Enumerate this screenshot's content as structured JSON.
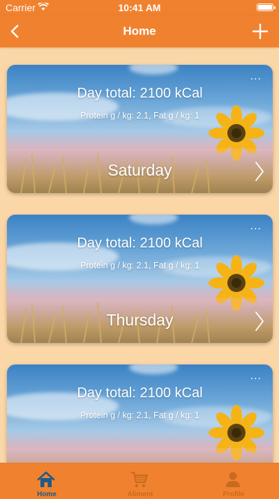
{
  "status": {
    "carrier": "Carrier",
    "time": "10:41 AM"
  },
  "navbar": {
    "title": "Home"
  },
  "colors": {
    "accent": "#f0822f",
    "background": "#fbd7a8",
    "tab_active": "#1f5a8a",
    "tab_inactive": "#c96a20"
  },
  "cards": [
    {
      "total": "Day total: 2100 kCal",
      "macros": "Protein g / kg: 2.1, Fat g / kg: 1",
      "day": "Saturday",
      "menu": "..."
    },
    {
      "total": "Day total: 2100 kCal",
      "macros": "Protein g / kg: 2.1, Fat g / kg: 1",
      "day": "Thursday",
      "menu": "..."
    },
    {
      "total": "Day total: 2100 kCal",
      "macros": "Protein g / kg: 2.1, Fat g / kg: 1",
      "day": "",
      "menu": "..."
    }
  ],
  "tabs": [
    {
      "label": "Home",
      "icon": "home-icon",
      "active": true
    },
    {
      "label": "Aliment",
      "icon": "cart-icon",
      "active": false
    },
    {
      "label": "Profile",
      "icon": "person-icon",
      "active": false
    }
  ]
}
